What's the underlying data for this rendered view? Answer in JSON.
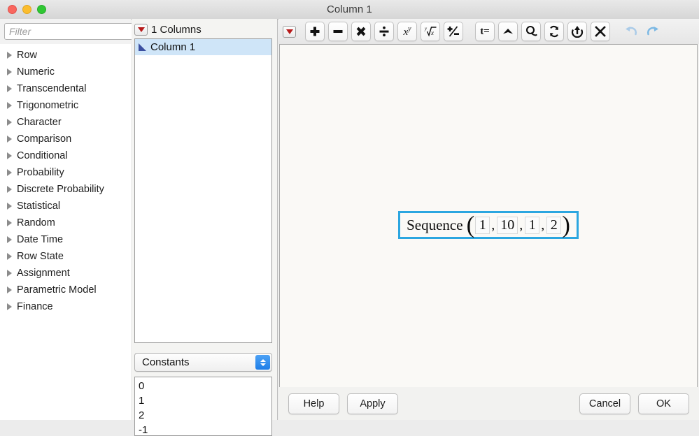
{
  "window": {
    "title": "Column 1",
    "traffic_lights": [
      "close",
      "minimize",
      "maximize"
    ]
  },
  "left_panel": {
    "filter": {
      "value": "",
      "placeholder": "Filter"
    },
    "clear_icon": "clear-x-icon",
    "items": [
      {
        "label": "Row"
      },
      {
        "label": "Numeric"
      },
      {
        "label": "Transcendental"
      },
      {
        "label": "Trigonometric"
      },
      {
        "label": "Character"
      },
      {
        "label": "Comparison"
      },
      {
        "label": "Conditional"
      },
      {
        "label": "Probability"
      },
      {
        "label": "Discrete Probability"
      },
      {
        "label": "Statistical"
      },
      {
        "label": "Random"
      },
      {
        "label": "Date Time"
      },
      {
        "label": "Row State"
      },
      {
        "label": "Assignment"
      },
      {
        "label": "Parametric Model"
      },
      {
        "label": "Finance"
      }
    ]
  },
  "columns_panel": {
    "header": "1 Columns",
    "header_menu_icon": "red-triangle-menu-icon",
    "columns": [
      {
        "name": "Column 1",
        "icon": "continuous-column-icon",
        "selected": true
      }
    ],
    "constants_select": {
      "label": "Constants",
      "stepper_icon": "stepper-updown-icon"
    },
    "constants": [
      "0",
      "1",
      "2",
      "-1"
    ]
  },
  "editor": {
    "menu_icon": "red-triangle-menu-icon",
    "toolbar": [
      {
        "name": "add-button",
        "glyph": "✚",
        "title": "Add"
      },
      {
        "name": "subtract-button",
        "glyph": "━",
        "title": "Subtract"
      },
      {
        "name": "multiply-button",
        "glyph": "✖",
        "title": "Multiply"
      },
      {
        "name": "divide-button",
        "glyph": "÷",
        "title": "Divide"
      },
      {
        "name": "power-button",
        "glyph": "xʸ",
        "title": "Power"
      },
      {
        "name": "root-button",
        "glyph": "ʸ√x",
        "title": "Root"
      },
      {
        "name": "sign-button",
        "glyph": "±",
        "title": "Change sign"
      },
      {
        "name": "local-assign-button",
        "glyph": "t=",
        "title": "Local variable assign"
      },
      {
        "name": "insert-above-button",
        "glyph": "caret",
        "title": "Insert"
      },
      {
        "name": "local-variable-button",
        "glyph": "lasso",
        "title": "Local variable"
      },
      {
        "name": "swap-button",
        "glyph": "swap",
        "title": "Swap"
      },
      {
        "name": "move-up-button",
        "glyph": "move-up",
        "title": "Move up"
      },
      {
        "name": "delete-button",
        "glyph": "✕",
        "title": "Delete"
      },
      {
        "name": "undo-button",
        "glyph": "undo",
        "title": "Undo"
      },
      {
        "name": "redo-button",
        "glyph": "redo",
        "title": "Redo"
      }
    ],
    "formula": {
      "function_name": "Sequence",
      "open_paren": "(",
      "close_paren": ")",
      "args": [
        "1",
        "10",
        "1",
        "2"
      ],
      "separator": ",",
      "selected": true,
      "selection_color": "#2ba6e0"
    },
    "buttons": {
      "help": "Help",
      "apply": "Apply",
      "cancel": "Cancel",
      "ok": "OK"
    }
  }
}
